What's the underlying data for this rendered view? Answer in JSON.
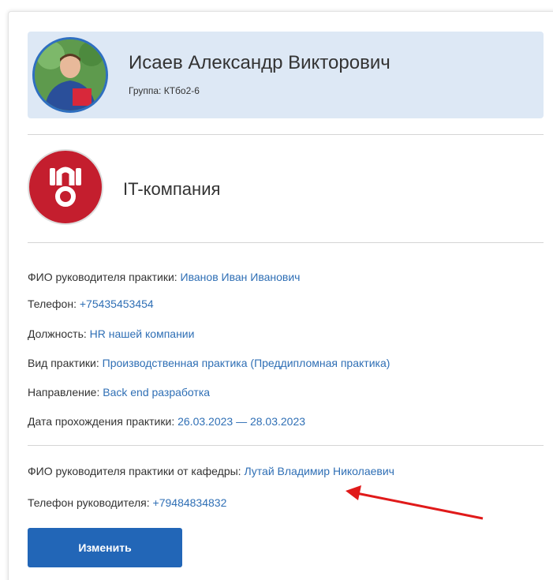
{
  "student": {
    "name": "Исаев Александр Викторович",
    "group": "Группа: КТбо2-6"
  },
  "company": {
    "name": "IT-компания"
  },
  "practice_info": [
    {
      "label": "ФИО руководителя практики:",
      "value": "Иванов Иван Иванович"
    },
    {
      "label": "Телефон:",
      "value": "+75435453454"
    },
    {
      "label": "Должность:",
      "value": "HR нашей компании"
    },
    {
      "label": "Вид практики:",
      "value": "Производственная практика (Преддипломная практика)"
    },
    {
      "label": "Направление:",
      "value": "Back end разработка"
    },
    {
      "label": "Дата прохождения практики:",
      "value": "26.03.2023 — 28.03.2023"
    }
  ],
  "department_info": [
    {
      "label": "ФИО руководителя практики от кафедры:",
      "value": "Лутай Владимир Николаевич"
    },
    {
      "label": "Телефон руководителя:",
      "value": "+79484834832"
    }
  ],
  "actions": {
    "edit_label": "Изменить"
  },
  "colors": {
    "accent": "#2266b7",
    "link": "#2f6fb5",
    "header_bg": "#dde8f5",
    "company_logo_bg": "#c41e2e",
    "annotation_arrow": "#e01a1a"
  }
}
